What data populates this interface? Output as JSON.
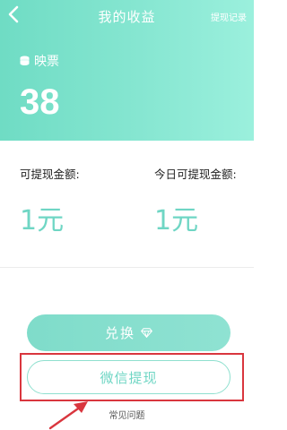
{
  "nav": {
    "title": "我的收益",
    "right_link": "提现记录"
  },
  "ticket": {
    "label": "映票",
    "value": "38"
  },
  "amounts": {
    "withdrawable_label": "可提现金额:",
    "withdrawable_value": "1元",
    "today_label": "今日可提现金额:",
    "today_value": "1元"
  },
  "buttons": {
    "exchange_label": "兑换",
    "wechat_withdraw_label": "微信提现"
  },
  "faq_link": "常见问题",
  "colors": {
    "accent": "#7fdcca",
    "highlight": "#d9363e"
  },
  "icons": {
    "back": "chevron-left-icon",
    "ticket": "coin-stack-icon",
    "diamond": "diamond-icon",
    "annotation_arrow": "arrow-icon"
  }
}
